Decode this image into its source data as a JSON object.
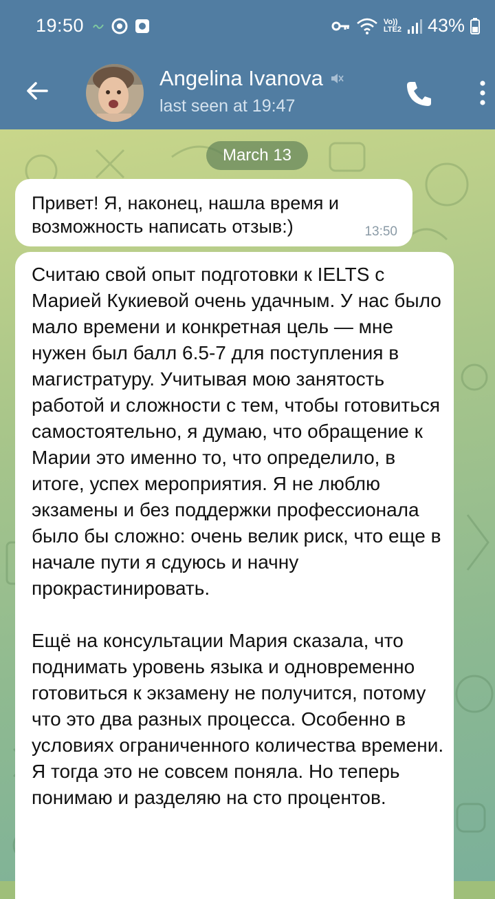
{
  "status_bar": {
    "time": "19:50",
    "icons_left": [
      "link-icon",
      "chrome-icon",
      "app-square-icon"
    ],
    "icons_right": [
      "key-icon",
      "wifi-icon",
      "volte-icon",
      "signal-icon",
      "battery-icon"
    ],
    "volte_label_top": "Vo))",
    "volte_label_bottom": "LTE2",
    "battery": "43%"
  },
  "header": {
    "title": "Angelina Ivanova",
    "subtitle": "last seen at 19:47",
    "muted": true,
    "colors": {
      "bar": "#517da2",
      "subtitle": "#d4e2ee"
    }
  },
  "chat": {
    "date_pill": "March 13",
    "messages": [
      {
        "text": "Привет! Я, наконец, нашла время и возможность написать отзыв:)",
        "time": "13:50"
      },
      {
        "text": "Считаю свой опыт подготовки к IELTS с Марией Кукиевой очень удачным. У нас было мало времени и конкретная цель — мне нужен был балл 6.5-7 для поступления в магистратуру. Учитывая мою занятость работой и сложности с тем, чтобы готовиться самостоятельно, я думаю, что обращение к Марии это именно то, что определило, в итоге, успех мероприятия. Я не люблю экзамены и без поддержки профессионала было бы сложно: очень велик риск, что еще в начале пути я сдуюсь и начну прокрастинировать.\n\nЕщё на консультации Мария сказала, что поднимать уровень языка и одновременно готовиться к экзамену не получится, потому что это два разных процесса. Особенно в условиях ограниченного количества времени. Я тогда это не совсем поняла. Но теперь понимаю и разделяю на сто процентов."
      }
    ]
  }
}
